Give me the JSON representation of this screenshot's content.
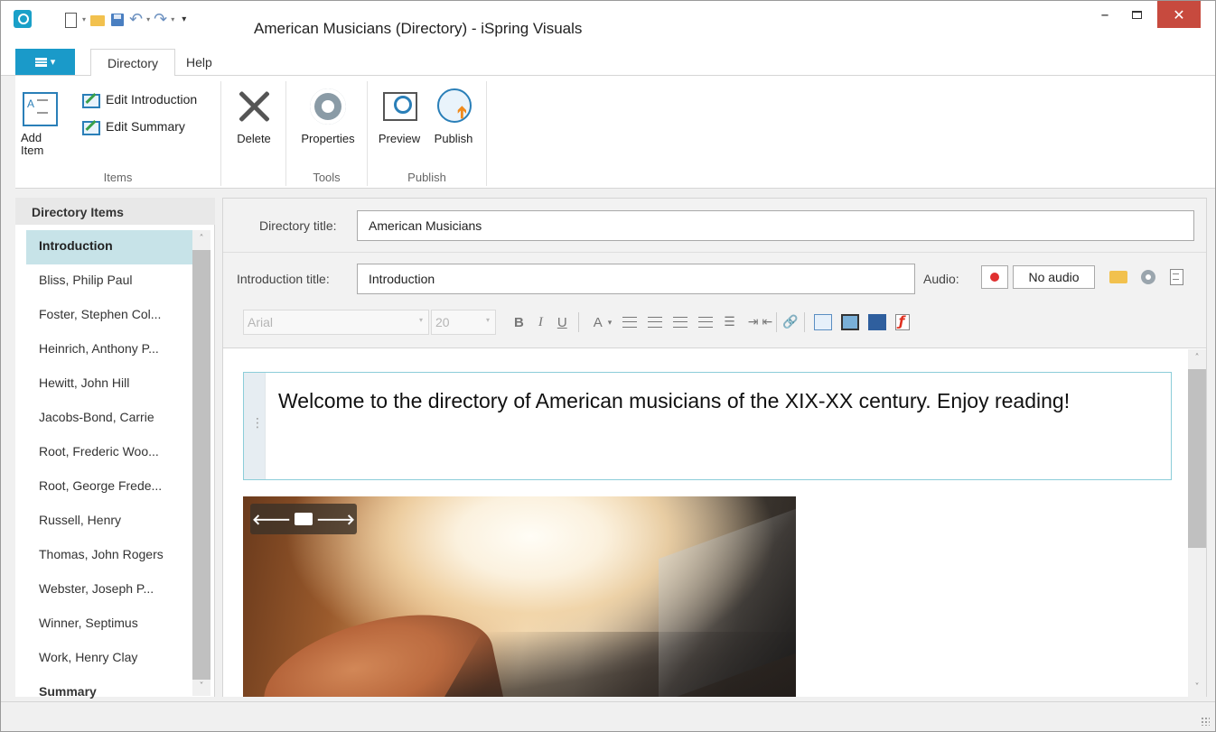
{
  "window": {
    "title": "American Musicians (Directory) - iSpring Visuals",
    "minimize_glyph": "–",
    "close_glyph": "✕"
  },
  "quick_access": {
    "undo_glyph": "↶",
    "redo_glyph": "↷",
    "more_glyph": "▾",
    "dropdown_glyph": "▾"
  },
  "ribbon": {
    "file_tab_caret": "▾",
    "tabs": [
      "Directory",
      "Help"
    ],
    "groups": {
      "items": {
        "label": "Items",
        "add_item": "Add\nItem",
        "edit_introduction": "Edit Introduction",
        "edit_summary": "Edit Summary"
      },
      "delete": {
        "label": "Delete"
      },
      "tools": {
        "label": "Tools",
        "properties": "Properties"
      },
      "publish": {
        "label": "Publish",
        "preview": "Preview",
        "publish": "Publish"
      }
    }
  },
  "left_pane": {
    "header": "Directory Items",
    "items": [
      "Introduction",
      "Bliss, Philip Paul",
      "Foster, Stephen Col...",
      "Heinrich, Anthony P...",
      "Hewitt, John Hill",
      "Jacobs-Bond, Carrie",
      "Root, Frederic Woo...",
      "Root, George Frede...",
      "Russell, Henry",
      "Thomas, John Rogers",
      "Webster, Joseph P...",
      "Winner, Septimus",
      "Work, Henry Clay",
      "Summary"
    ],
    "selected": "Introduction"
  },
  "properties": {
    "directory_title_label": "Directory title:",
    "directory_title_value": "American Musicians",
    "intro_title_label": "Introduction title:",
    "intro_title_value": "Introduction",
    "audio_label": "Audio:",
    "audio_value": "No audio"
  },
  "format_toolbar": {
    "font": "Arial",
    "size": "20",
    "bold": "B",
    "italic": "I",
    "underline": "U",
    "font_color": "A",
    "link_glyph": "🔗",
    "bullets_glyph": "☰",
    "indent_in": "⇥",
    "indent_out": "⇤"
  },
  "editor": {
    "welcome_text": "Welcome to the directory of American musicians of the XIX-XX century. Enjoy reading!",
    "image_nav": {
      "prev": "🡐",
      "next": "🡒"
    }
  },
  "scrollbar": {
    "up": "˄",
    "down": "˅"
  },
  "colors": {
    "accent": "#1a9ac9",
    "selected_item": "#c7e3e8",
    "close_button": "#c74a3e",
    "record": "#e03030"
  }
}
